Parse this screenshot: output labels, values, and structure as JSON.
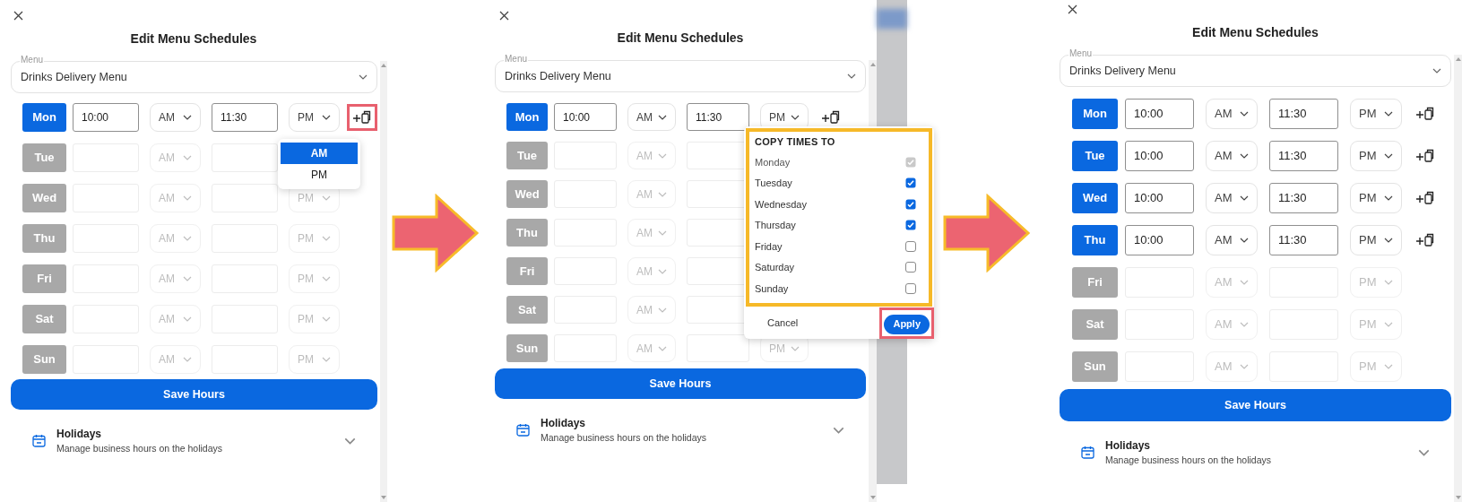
{
  "panels": [
    {
      "title": "Edit Menu Schedules",
      "menu": {
        "label": "Menu",
        "value": "Drinks Delivery Menu"
      },
      "rows": [
        {
          "day": "Mon",
          "enabled": true,
          "start": "10:00",
          "start_period": "AM",
          "end": "11:30",
          "end_period": "PM",
          "copy_highlighted": true,
          "period_dropdown": [
            {
              "label": "AM",
              "selected": true
            },
            {
              "label": "PM",
              "selected": false
            }
          ]
        },
        {
          "day": "Tue",
          "enabled": false,
          "start_period": "AM"
        },
        {
          "day": "Wed",
          "enabled": false,
          "start_period": "AM",
          "end_period": "PM"
        },
        {
          "day": "Thu",
          "enabled": false,
          "start_period": "AM",
          "end_period": "PM"
        },
        {
          "day": "Fri",
          "enabled": false,
          "start_period": "AM",
          "end_period": "PM"
        },
        {
          "day": "Sat",
          "enabled": false,
          "start_period": "AM",
          "end_period": "PM"
        },
        {
          "day": "Sun",
          "enabled": false,
          "start_period": "AM",
          "end_period": "PM"
        }
      ],
      "save_button": "Save Hours",
      "holidays": {
        "title": "Holidays",
        "subtitle": "Manage business hours on the holidays"
      }
    },
    {
      "title": "Edit Menu Schedules",
      "menu": {
        "label": "Menu",
        "value": "Drinks Delivery Menu"
      },
      "rows": [
        {
          "day": "Mon",
          "enabled": true,
          "start": "10:00",
          "start_period": "AM",
          "end": "11:30",
          "end_period": "PM",
          "copy_highlighted": false
        },
        {
          "day": "Tue",
          "enabled": false,
          "start_period": "AM"
        },
        {
          "day": "Wed",
          "enabled": false,
          "start_period": "AM"
        },
        {
          "day": "Thu",
          "enabled": false,
          "start_period": "AM"
        },
        {
          "day": "Fri",
          "enabled": false,
          "start_period": "AM"
        },
        {
          "day": "Sat",
          "enabled": false,
          "start_period": "AM"
        },
        {
          "day": "Sun",
          "enabled": false,
          "start_period": "AM",
          "end_period": "PM"
        }
      ],
      "copy_popup": {
        "title": "COPY TIMES TO",
        "list_highlighted": true,
        "days": [
          {
            "label": "Monday",
            "checked": true,
            "disabled": true
          },
          {
            "label": "Tuesday",
            "checked": true,
            "disabled": false
          },
          {
            "label": "Wednesday",
            "checked": true,
            "disabled": false
          },
          {
            "label": "Thursday",
            "checked": true,
            "disabled": false
          },
          {
            "label": "Friday",
            "checked": false,
            "disabled": false
          },
          {
            "label": "Saturday",
            "checked": false,
            "disabled": false
          },
          {
            "label": "Sunday",
            "checked": false,
            "disabled": false
          }
        ],
        "cancel_button": "Cancel",
        "apply_button": {
          "label": "Apply",
          "highlighted": true
        }
      },
      "save_button": "Save Hours",
      "holidays": {
        "title": "Holidays",
        "subtitle": "Manage business hours on the holidays"
      }
    },
    {
      "title": "Edit Menu Schedules",
      "menu": {
        "label": "Menu",
        "value": "Drinks Delivery Menu"
      },
      "rows": [
        {
          "day": "Mon",
          "enabled": true,
          "start": "10:00",
          "start_period": "AM",
          "end": "11:30",
          "end_period": "PM",
          "copy_highlighted": false
        },
        {
          "day": "Tue",
          "enabled": true,
          "start": "10:00",
          "start_period": "AM",
          "end": "11:30",
          "end_period": "PM",
          "copy_highlighted": false
        },
        {
          "day": "Wed",
          "enabled": true,
          "start": "10:00",
          "start_period": "AM",
          "end": "11:30",
          "end_period": "PM",
          "copy_highlighted": false
        },
        {
          "day": "Thu",
          "enabled": true,
          "start": "10:00",
          "start_period": "AM",
          "end": "11:30",
          "end_period": "PM",
          "copy_highlighted": false
        },
        {
          "day": "Fri",
          "enabled": false,
          "start_period": "AM",
          "end_period": "PM"
        },
        {
          "day": "Sat",
          "enabled": false,
          "start_period": "AM",
          "end_period": "PM"
        },
        {
          "day": "Sun",
          "enabled": false,
          "start_period": "AM",
          "end_period": "PM"
        }
      ],
      "save_button": "Save Hours",
      "holidays": {
        "title": "Holidays",
        "subtitle": "Manage business hours on the holidays"
      }
    }
  ]
}
